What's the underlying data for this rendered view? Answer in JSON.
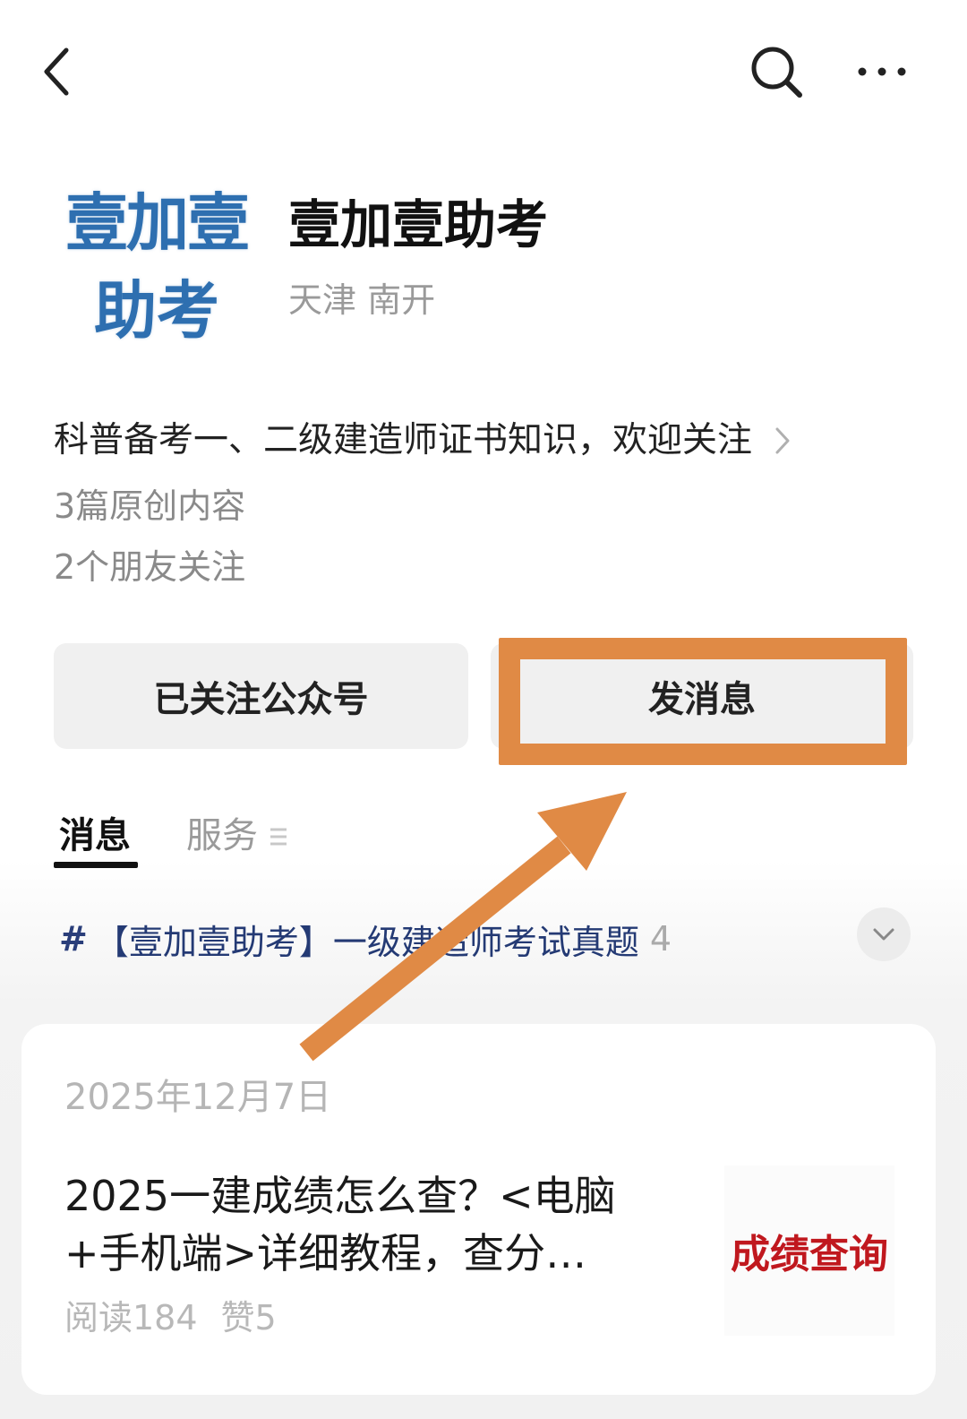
{
  "topbar": {
    "back_icon": "chevron-left-icon",
    "search_icon": "search-icon",
    "more_icon": "more-horizontal-icon"
  },
  "profile": {
    "logo_line1": "壹加壹",
    "logo_line2": "助考",
    "name": "壹加壹助考",
    "location": "天津 南开",
    "description": "科普备考一、二级建造师证书知识，欢迎关注",
    "original_count": "3篇原创内容",
    "friends_following": "2个朋友关注"
  },
  "actions": {
    "follow_label": "已关注公众号",
    "message_label": "发消息",
    "highlight_color": "#e08a45"
  },
  "tabs": [
    {
      "label": "消息",
      "active": true
    },
    {
      "label": "服务",
      "active": false
    }
  ],
  "topic": {
    "hash": "#",
    "title": "【壹加壹助考】一级建造师考试真题",
    "count": "4"
  },
  "article": {
    "date": "2025年12月7日",
    "title": "2025一建成绩怎么查？<电脑+手机端>详细教程，查分…",
    "reads": "阅读184",
    "likes": "赞5",
    "thumbnail_text": "成绩查询"
  },
  "colors": {
    "accent_orange": "#e08a45",
    "logo_blue": "#2e6fb0",
    "topic_blue": "#243a74",
    "thumbnail_red": "#c0181e"
  }
}
